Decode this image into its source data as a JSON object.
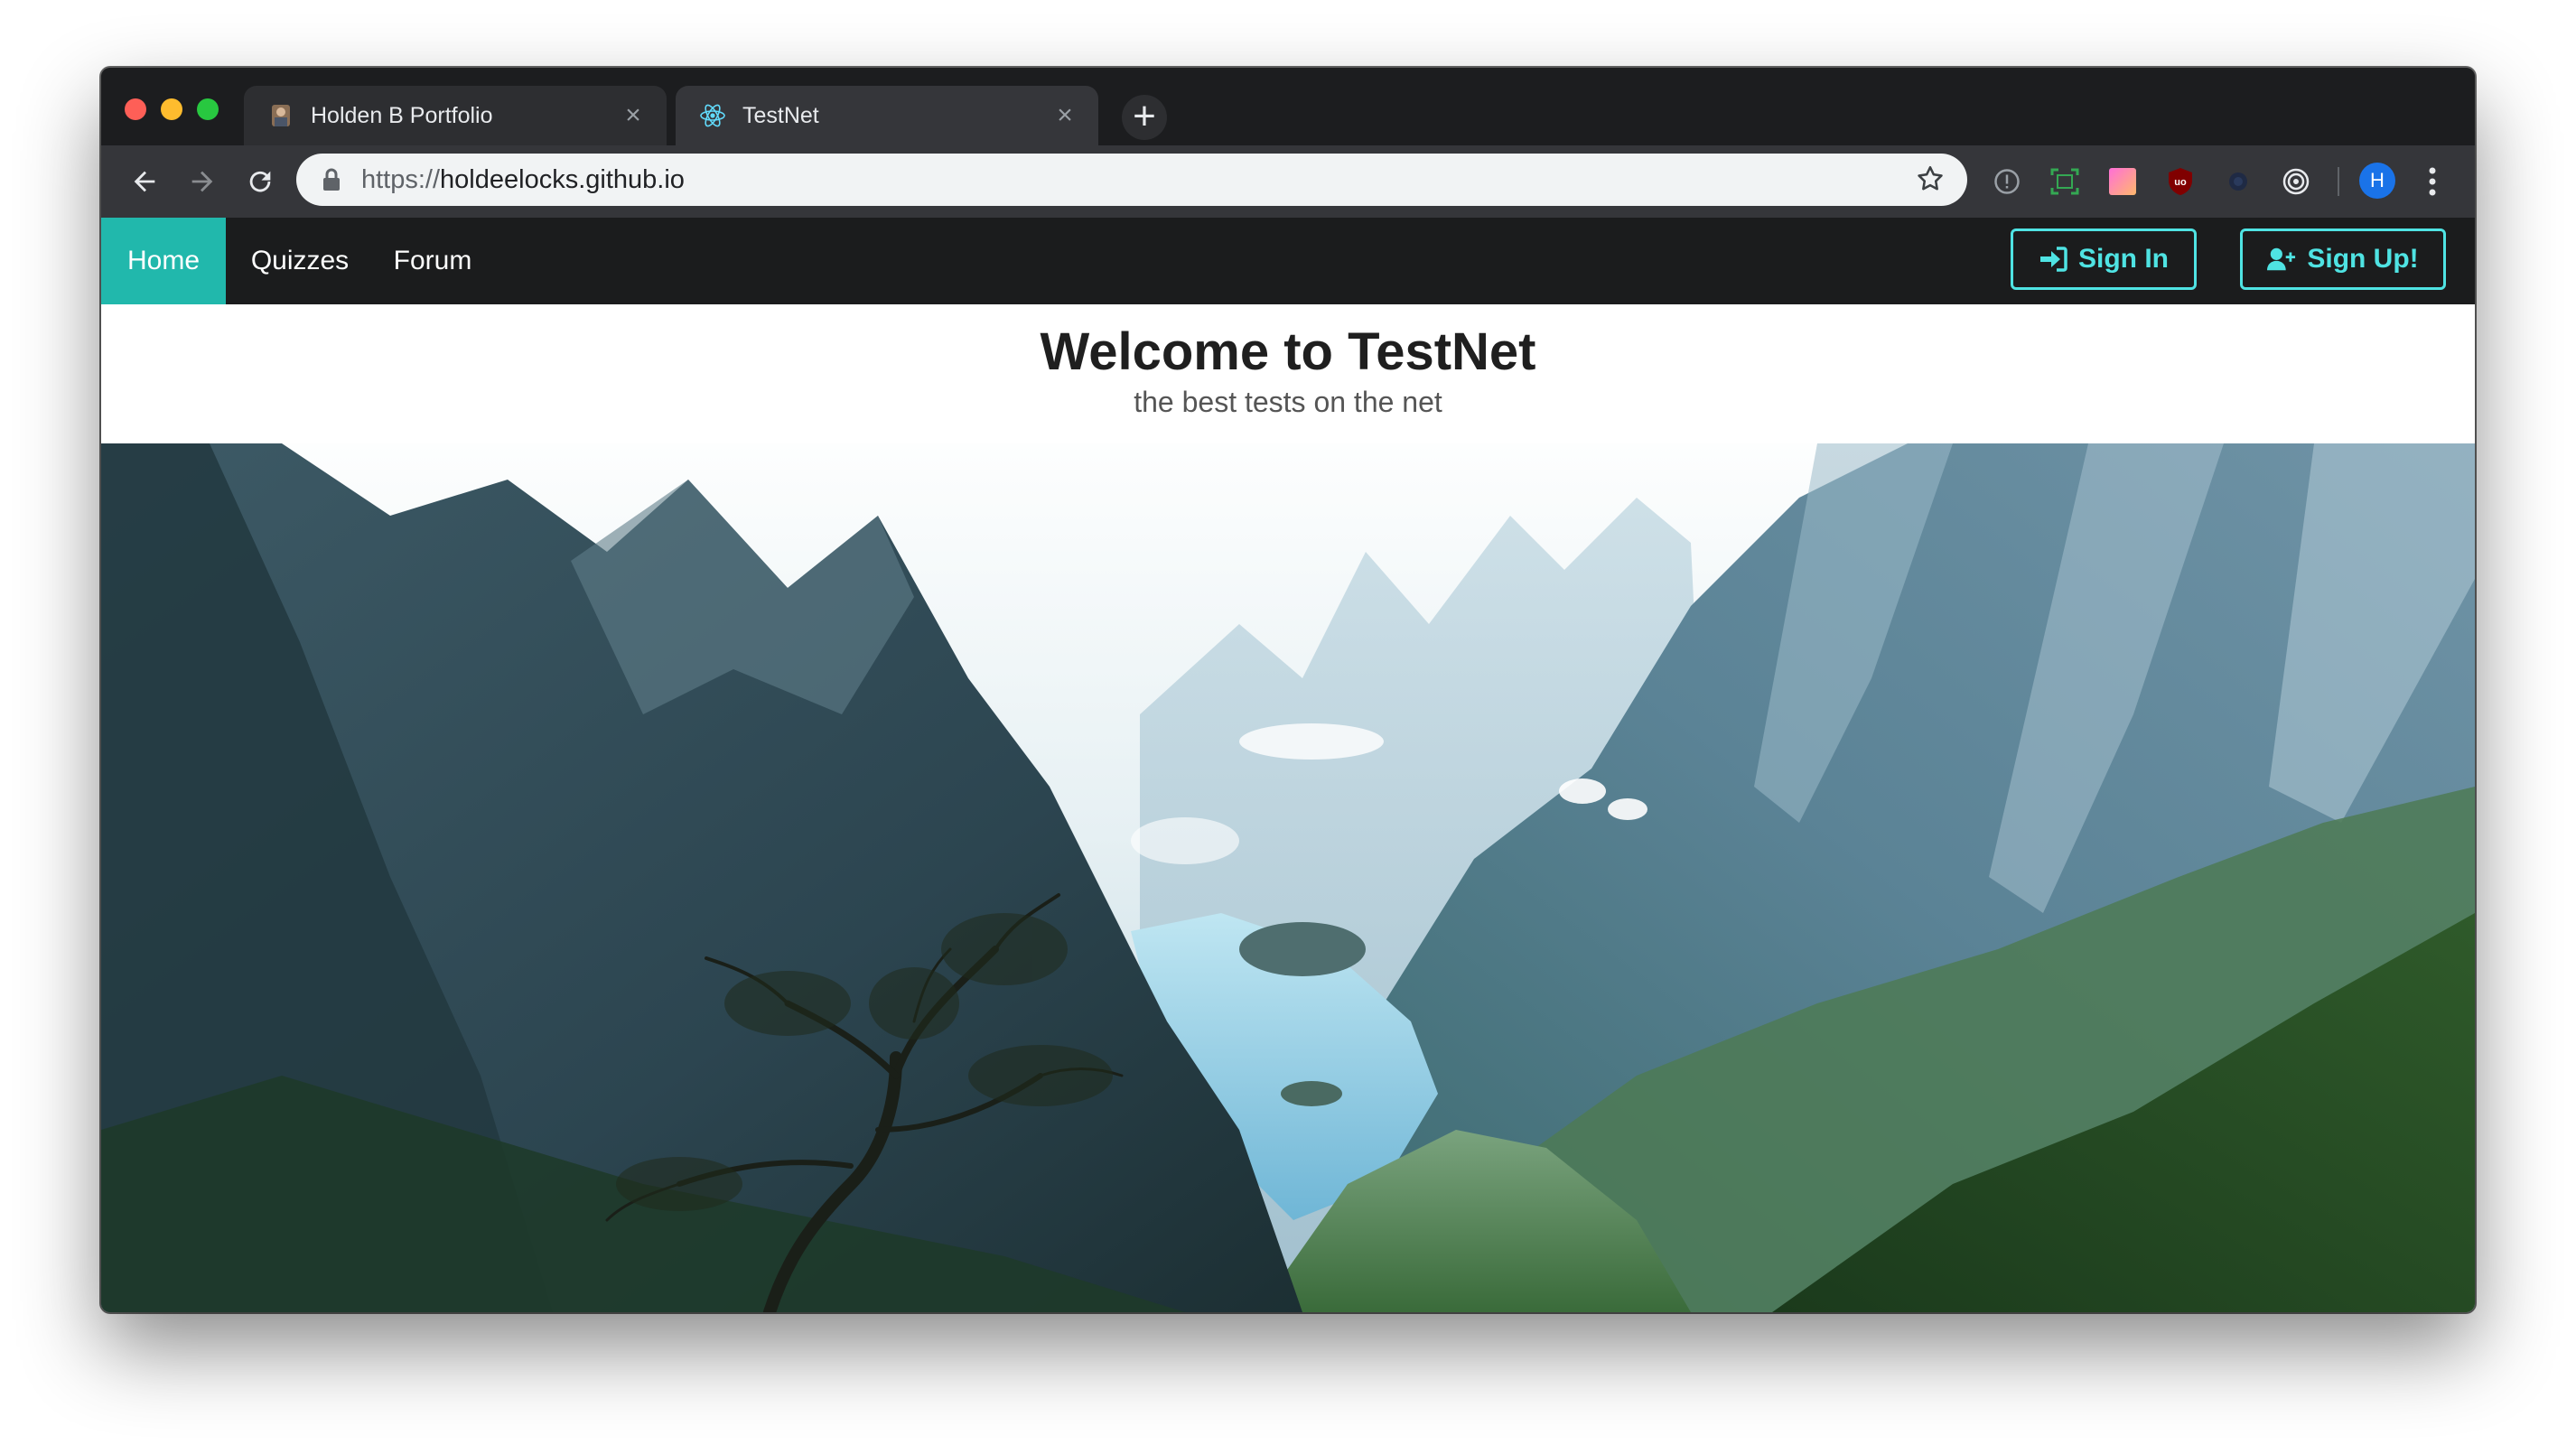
{
  "browser": {
    "tabs": [
      {
        "title": "Holden B Portfolio",
        "active": false,
        "favicon": "portfolio-favicon"
      },
      {
        "title": "TestNet",
        "active": true,
        "favicon": "react-atom-icon"
      }
    ],
    "new_tab_label": "+",
    "url_scheme": "https://",
    "url_host": "holdeelocks.github.io",
    "profile_initial": "H",
    "extensions": [
      "info-icon",
      "screenshot-icon",
      "gradient-icon",
      "ublock-icon",
      "dark-extension-icon",
      "target-icon"
    ]
  },
  "site": {
    "nav": {
      "home": "Home",
      "quizzes": "Quizzes",
      "forum": "Forum",
      "sign_in": "Sign In",
      "sign_up": "Sign Up!"
    },
    "hero": {
      "title": "Welcome to TestNet",
      "subtitle": "the best tests on the net"
    },
    "colors": {
      "accent": "#21b8ac",
      "button_outline": "#4fe3e3",
      "nav_bg": "#1b1c1d"
    }
  }
}
